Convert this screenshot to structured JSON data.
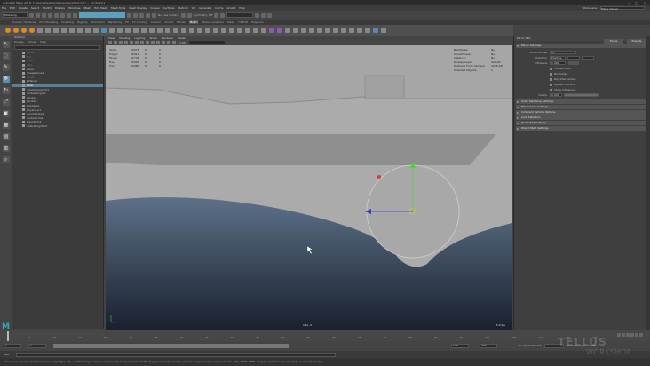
{
  "window": {
    "title": "Autodesk Maya 2018: C:/Users/Desktop/scenes/waveShot.mb* --- pCylinder1"
  },
  "menubar": {
    "items": [
      "File",
      "Edit",
      "Create",
      "Select",
      "Modify",
      "Display",
      "Windows",
      "Mesh",
      "Edit Mesh",
      "Mesh Tools",
      "Mesh Display",
      "Curves",
      "Surfaces",
      "Deform",
      "UV",
      "Generate",
      "Cache",
      "Arnold",
      "Help"
    ],
    "workspace_label": "Workspace:",
    "workspace_value": "Maya Classic"
  },
  "statusline": {
    "mode": "Modeling",
    "live_label": "No Live Surface",
    "symmetry": "Symmetry: Off"
  },
  "shelf": {
    "tabs": [
      "Curves / Surfaces",
      "Poly Modeling",
      "Sculpting",
      "Rigging",
      "Animation",
      "Rendering",
      "FX",
      "FX Caching",
      "Custom",
      "Arnold",
      "Bifrost",
      "MASH",
      "Motion Graphics",
      "XGen",
      "TURTLE",
      "Polygons"
    ],
    "active_tab": "MASH"
  },
  "toolbox": {
    "tools": [
      "select",
      "lasso",
      "paint",
      "move",
      "rotate",
      "scale"
    ]
  },
  "outliner": {
    "title": "Outliner",
    "menu": [
      "Display",
      "Show",
      "Help"
    ],
    "items": [
      {
        "label": "persp",
        "dim": true
      },
      {
        "label": "top",
        "dim": true
      },
      {
        "label": "front",
        "dim": true
      },
      {
        "label": "side",
        "dim": true
      },
      {
        "label": "wave",
        "dim": false
      },
      {
        "label": "imagePlane1",
        "dim": false
      },
      {
        "label": "ocean",
        "dim": true
      },
      {
        "label": "pPlane1",
        "dim": false
      },
      {
        "label": "boat",
        "dim": false,
        "selected": true
      },
      {
        "label": "directionalLight1",
        "dim": false
      },
      {
        "label": "ambientLight1",
        "dim": false
      },
      {
        "label": "pCube1",
        "dim": false
      },
      {
        "label": "pCube2",
        "dim": false
      },
      {
        "label": "pSphere1",
        "dim": false
      },
      {
        "label": "pCylinder1",
        "dim": false
      },
      {
        "label": "curveShape1",
        "dim": false
      },
      {
        "label": "nurbsCircle1",
        "dim": false
      },
      {
        "label": "transform1",
        "dim": false
      },
      {
        "label": "defaultLightSet",
        "dim": false
      }
    ]
  },
  "viewport": {
    "menu": [
      "View",
      "Shading",
      "Lighting",
      "Show",
      "Renderer",
      "Panels"
    ],
    "hud": [
      {
        "name": "Verts:",
        "a": "32678",
        "b": "0",
        "c": "0"
      },
      {
        "name": "Edges:",
        "a": "65412",
        "b": "0",
        "c": "0"
      },
      {
        "name": "Faces:",
        "a": "32736",
        "b": "0",
        "c": "0"
      },
      {
        "name": "Tris:",
        "a": "65400",
        "b": "0",
        "c": "0"
      },
      {
        "name": "UVs:",
        "a": "33489",
        "b": "0",
        "c": "0"
      }
    ],
    "hud_right": [
      {
        "name": "Backfaces:",
        "v": "N/A"
      },
      {
        "name": "Smoothness:",
        "v": "N/A"
      },
      {
        "name": "Instance:",
        "v": "No"
      },
      {
        "name": "Display Layer:",
        "v": "default"
      },
      {
        "name": "Distance From Camera:",
        "v": "3056.468"
      },
      {
        "name": "Selected Objects:",
        "v": "1"
      }
    ],
    "camera_label": "side -X",
    "fps_label": "5.9 fps",
    "field_value": "1.00"
  },
  "attribute_editor": {
    "title": "Mirror Skin",
    "tab": "Mirror Skin",
    "buttons": [
      "Focus",
      "Presets"
    ],
    "sections": [
      {
        "label": "Mirror Settings",
        "open": true
      },
      {
        "label": "Color Sampling Settings",
        "open": false
      },
      {
        "label": "Mirror Scan Settings",
        "open": false
      },
      {
        "label": "Coherent Particle Options",
        "open": false
      },
      {
        "label": "Lock Selection",
        "open": false
      },
      {
        "label": "Quick Edit Settings",
        "open": false
      },
      {
        "label": "Direct Paint Settings",
        "open": false
      }
    ],
    "rows": [
      {
        "label": "Mirror Across",
        "value": "XY"
      },
      {
        "label": "Direction",
        "value": "Positive"
      },
      {
        "label": "Influence",
        "value": "1.000"
      },
      {
        "label": "Clamp",
        "value": "0.000"
      }
    ],
    "checkboxes": [
      "Closest Point",
      "Normalize",
      "Ray Intersection",
      "Rebuild Surface",
      "Show Influences"
    ]
  },
  "timeslider": {
    "ticks": [
      "5",
      "10",
      "15",
      "20",
      "25",
      "30",
      "35",
      "40",
      "45",
      "50",
      "55",
      "60",
      "65",
      "70",
      "75",
      "80",
      "85",
      "90",
      "95",
      "100",
      "105",
      "110",
      "115",
      "120"
    ],
    "current_frame": "1"
  },
  "rangeslider": {
    "start": "1",
    "inner_start": "1",
    "inner_end": "120",
    "end": "200",
    "char_set": "No Character Set",
    "anim_layer": "No Anim Layer",
    "fps": "24 fps"
  },
  "cmdline": {
    "language": "MEL"
  },
  "helpline": {
    "text": "Move Tool: Use manipulator to move object(s). Ctrl+middle-drag to move components along normals. Shift+drag manipulator axis to extrude components or clone objects. Ctrl+Shift+LMB+drag to constrain movement to a connected edge."
  },
  "watermark": {
    "line1": "TELLUS",
    "line2": "WORKSHOP"
  },
  "colors": {
    "accent": "#5aa0c0",
    "selection": "#5a7f9a",
    "maya_logo": "#2aa9b8",
    "water_top": "#5d7189",
    "water_bottom": "#19212e",
    "manip_y": "#4fcf3a",
    "manip_z": "#3a3ad0",
    "manip_x": "#d04040"
  }
}
